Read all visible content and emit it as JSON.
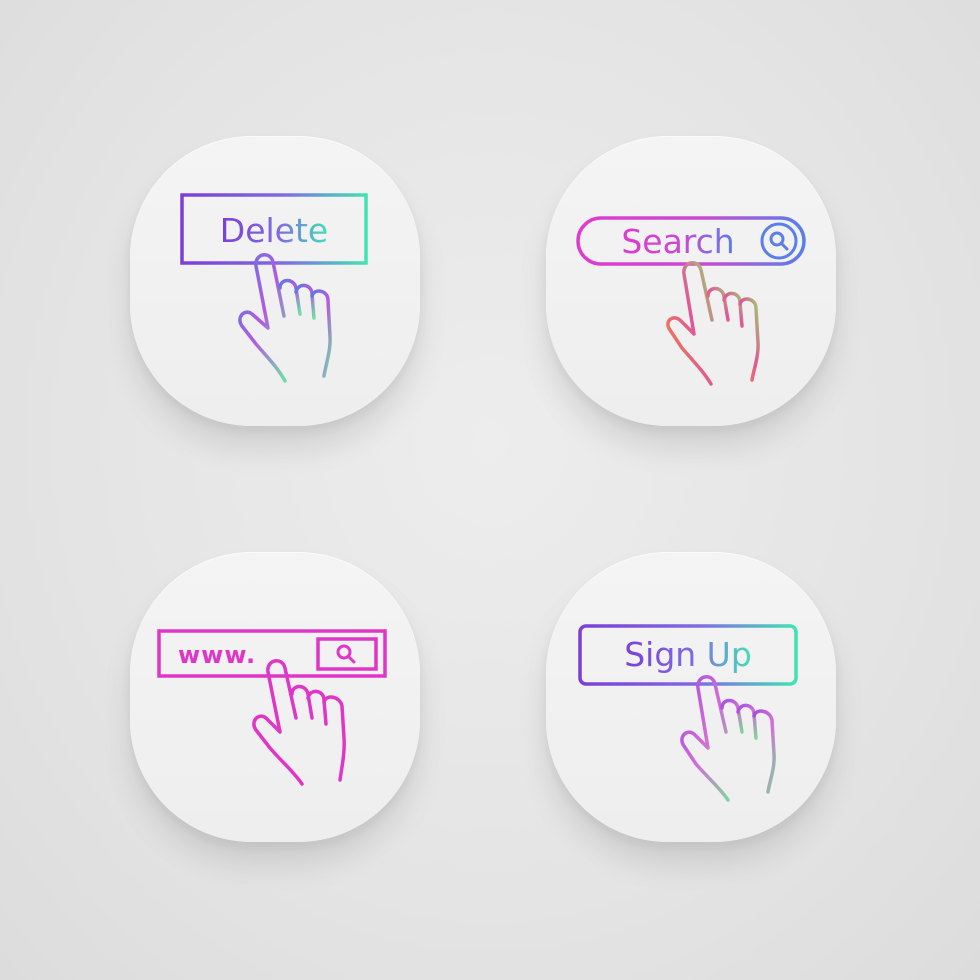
{
  "tiles": [
    {
      "id": "delete",
      "label": "Delete"
    },
    {
      "id": "search",
      "label": "Search"
    },
    {
      "id": "www",
      "label": "www."
    },
    {
      "id": "signup",
      "label": "Sign Up"
    }
  ],
  "icons": [
    "cursor-hand-icon",
    "magnifier-icon"
  ],
  "colors": {
    "background": "#e4e4e4",
    "tile": "#f1f1f1",
    "gradient_purple": "#7b3fd8",
    "gradient_teal": "#3fe3b4",
    "gradient_pink": "#e03ad0",
    "gradient_orange": "#f0894a",
    "gradient_blue": "#5a7fe8",
    "magenta": "#e036c8"
  }
}
